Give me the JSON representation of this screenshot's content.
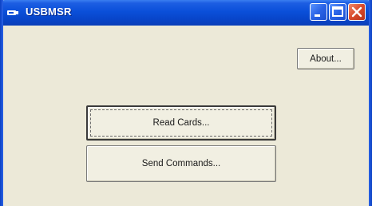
{
  "window": {
    "title": "USBMSR",
    "accent_color": "#0a4fd9",
    "client_color": "#ece9d8",
    "close_color": "#d94a2a"
  },
  "caption_buttons": {
    "minimize_icon": "minimize-icon",
    "maximize_icon": "maximize-icon",
    "close_icon": "close-icon"
  },
  "buttons": {
    "about_label": "About...",
    "read_cards_label": "Read Cards...",
    "send_commands_label": "Send Commands..."
  }
}
